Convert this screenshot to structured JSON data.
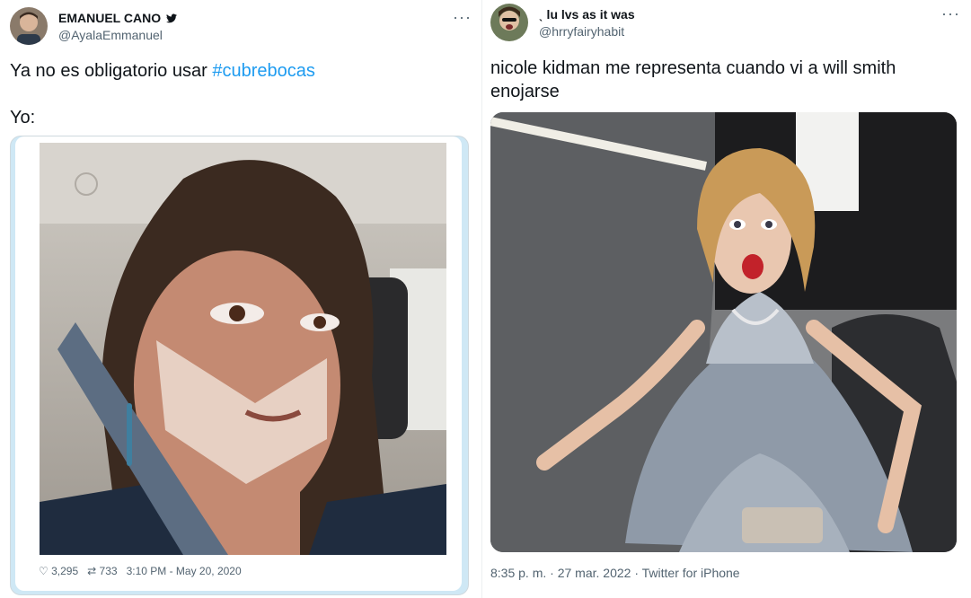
{
  "left_tweet": {
    "name": "EMANUEL CANO",
    "verified_icon": "twitter-bird-icon",
    "handle": "@AyalaEmmanuel",
    "more": "···",
    "text_prefix": "Ya no es obligatorio usar ",
    "hashtag": "#cubrebocas",
    "text_line2": "Yo:",
    "likes": "3,295",
    "retweets": "733",
    "timestamp": "3:10 PM - May 20, 2020"
  },
  "right_tweet": {
    "name": "ˎ lu lvs as it was",
    "handle": "@hrryfairyhabit",
    "more": "···",
    "text": "nicole kidman me representa cuando vi a will smith enojarse",
    "time": "8:35 p. m.",
    "date": "27 mar. 2022",
    "source": "Twitter for iPhone"
  },
  "colors": {
    "hashtag": "#1d9bf0",
    "muted": "#536471",
    "card_border": "#cfe8f5"
  }
}
